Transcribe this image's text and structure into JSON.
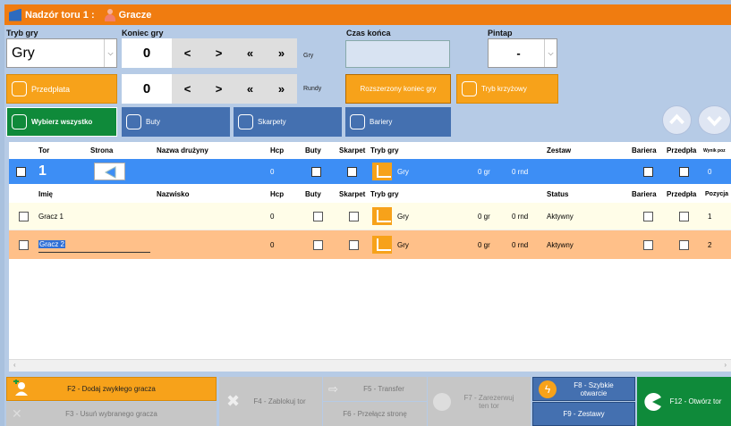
{
  "window": {
    "title": "Nadzór toru 1 :",
    "section": "Gracze"
  },
  "controls": {
    "tryb_gry_label": "Tryb gry",
    "tryb_gry_value": "Gry",
    "koniec_gry_label": "Koniec gry",
    "koniec_gry_value": "0",
    "koniec_gry_unit": "Gry",
    "rundy_value": "0",
    "rundy_unit": "Rundy",
    "nav1": [
      "<",
      ">",
      "«",
      "»"
    ],
    "nav2": [
      "<",
      ">",
      "«",
      "»"
    ],
    "czas_konca_label": "Czas końca",
    "pintap_label": "Pintap",
    "pintap_value": "-",
    "przedplata": "Przedpłata",
    "rozszerzony": "Rozszerzony koniec gry",
    "tryb_krzyzowy": "Tryb krzyżowy",
    "wybierz": "Wybierz wszystko",
    "buty": "Buty",
    "skarpety": "Skarpety",
    "bariery": "Bariery"
  },
  "lane_header": {
    "tor": "Tor",
    "strona": "Strona",
    "nazwa": "Nazwa drużyny",
    "hcp": "Hcp",
    "buty": "Buty",
    "skarpet": "Skarpet",
    "tryb": "Tryb gry",
    "zestaw": "Zestaw",
    "bariera": "Bariera",
    "przedpla": "Przedpła",
    "wynik": "Wynik poz"
  },
  "lane_row": {
    "tor": "1",
    "hcp": "0",
    "tryb": "Gry",
    "gr": "0 gr",
    "rnd": "0 rnd",
    "wynik": "0"
  },
  "player_header": {
    "imie": "Imię",
    "nazwisko": "Nazwisko",
    "hcp": "Hcp",
    "buty": "Buty",
    "skarpet": "Skarpet",
    "tryb": "Tryb gry",
    "status": "Status",
    "bariera": "Bariera",
    "przedpla": "Przedpła",
    "pozycja": "Pozycja"
  },
  "players": [
    {
      "imie": "Gracz 1",
      "hcp": "0",
      "tryb": "Gry",
      "gr": "0 gr",
      "rnd": "0 rnd",
      "status": "Aktywny",
      "pozycja": "1"
    },
    {
      "imie": "Gracz 2",
      "hcp": "0",
      "tryb": "Gry",
      "gr": "0 gr",
      "rnd": "0 rnd",
      "status": "Aktywny",
      "pozycja": "2"
    }
  ],
  "footer": {
    "f2": "F2 - Dodaj zwykłego gracza",
    "f3": "F3 - Usuń wybranego gracza",
    "f4": "F4 - Zablokuj tor",
    "f5": "F5 - Transfer",
    "f6": "F6 - Przełącz stronę",
    "f7": "F7 - Zarezerwuj ten tor",
    "f8": "F8 - Szybkie otwarcie",
    "f9": "F9 - Zestawy",
    "f12": "F12 - Otwórz tor"
  },
  "colors": {
    "orange": "#f07c10",
    "blue": "#4470b0",
    "selected": "#3d8ef5",
    "highlight": "#ffc089",
    "green": "#0f8a3a"
  }
}
